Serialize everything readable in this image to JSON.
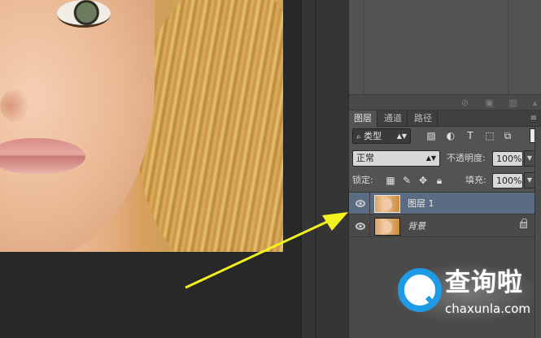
{
  "panel": {
    "tabs": [
      {
        "label": "图层",
        "active": true
      },
      {
        "label": "通道",
        "active": false
      },
      {
        "label": "路径",
        "active": false
      }
    ],
    "filter": {
      "label": "类型",
      "icon": "search-icon"
    },
    "filter_icons": [
      "image-filter-icon",
      "adjustment-filter-icon",
      "type-filter-icon",
      "shape-filter-icon",
      "smart-object-filter-icon"
    ],
    "blend_mode": "正常",
    "opacity": {
      "label": "不透明度:",
      "value": "100%"
    },
    "lock": {
      "label": "锁定:",
      "icons": [
        "lock-transparent-icon",
        "lock-brush-icon",
        "lock-move-icon",
        "lock-all-icon"
      ]
    },
    "fill": {
      "label": "填充:",
      "value": "100%"
    },
    "layers": [
      {
        "name": "图层 1",
        "selected": true,
        "visible": true,
        "locked": false
      },
      {
        "name": "背景",
        "selected": false,
        "visible": true,
        "locked": true
      }
    ]
  },
  "watermark": {
    "title": "查询啦",
    "url": "chaxunla.com",
    "colors": {
      "accent": "#1f9be6"
    }
  },
  "colors": {
    "panel_bg": "#535353",
    "selected_layer": "#5a6b83",
    "arrow": "#f2f21e"
  }
}
